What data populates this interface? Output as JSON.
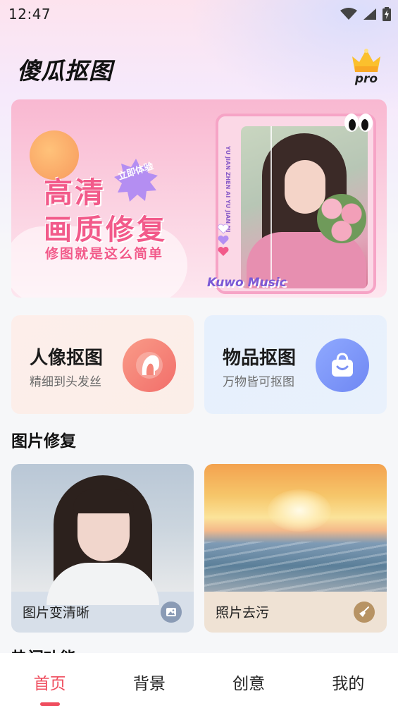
{
  "status_bar": {
    "time": "12:47"
  },
  "header": {
    "app_title": "傻瓜抠图",
    "pro_label": "pro"
  },
  "banner": {
    "title_line1": "高清",
    "title_line2": "画质修复",
    "subtitle": "修图就是这么简单",
    "badge": "立即体验",
    "frame_text": "YU JIAN ZHEN AI YU JIAN NI",
    "brand": "Kuwo Music"
  },
  "features": [
    {
      "title": "人像抠图",
      "subtitle": "精细到头发丝",
      "icon": "portrait-silhouette-icon",
      "accent": "#f2766c"
    },
    {
      "title": "物品抠图",
      "subtitle": "万物皆可抠图",
      "icon": "shopping-bag-icon",
      "accent": "#7b91f5"
    }
  ],
  "section": {
    "title": "图片修复"
  },
  "repair_cards": [
    {
      "label": "图片变清晰",
      "icon": "image-icon",
      "accent": "#8a9bb5"
    },
    {
      "label": "照片去污",
      "icon": "broom-icon",
      "accent": "#b79364"
    }
  ],
  "hot_section": {
    "title": "热门功能"
  },
  "bottom_nav": {
    "items": [
      {
        "label": "首页",
        "active": true
      },
      {
        "label": "背景",
        "active": false
      },
      {
        "label": "创意",
        "active": false
      },
      {
        "label": "我的",
        "active": false
      }
    ],
    "active_color": "#ef4d5e"
  }
}
